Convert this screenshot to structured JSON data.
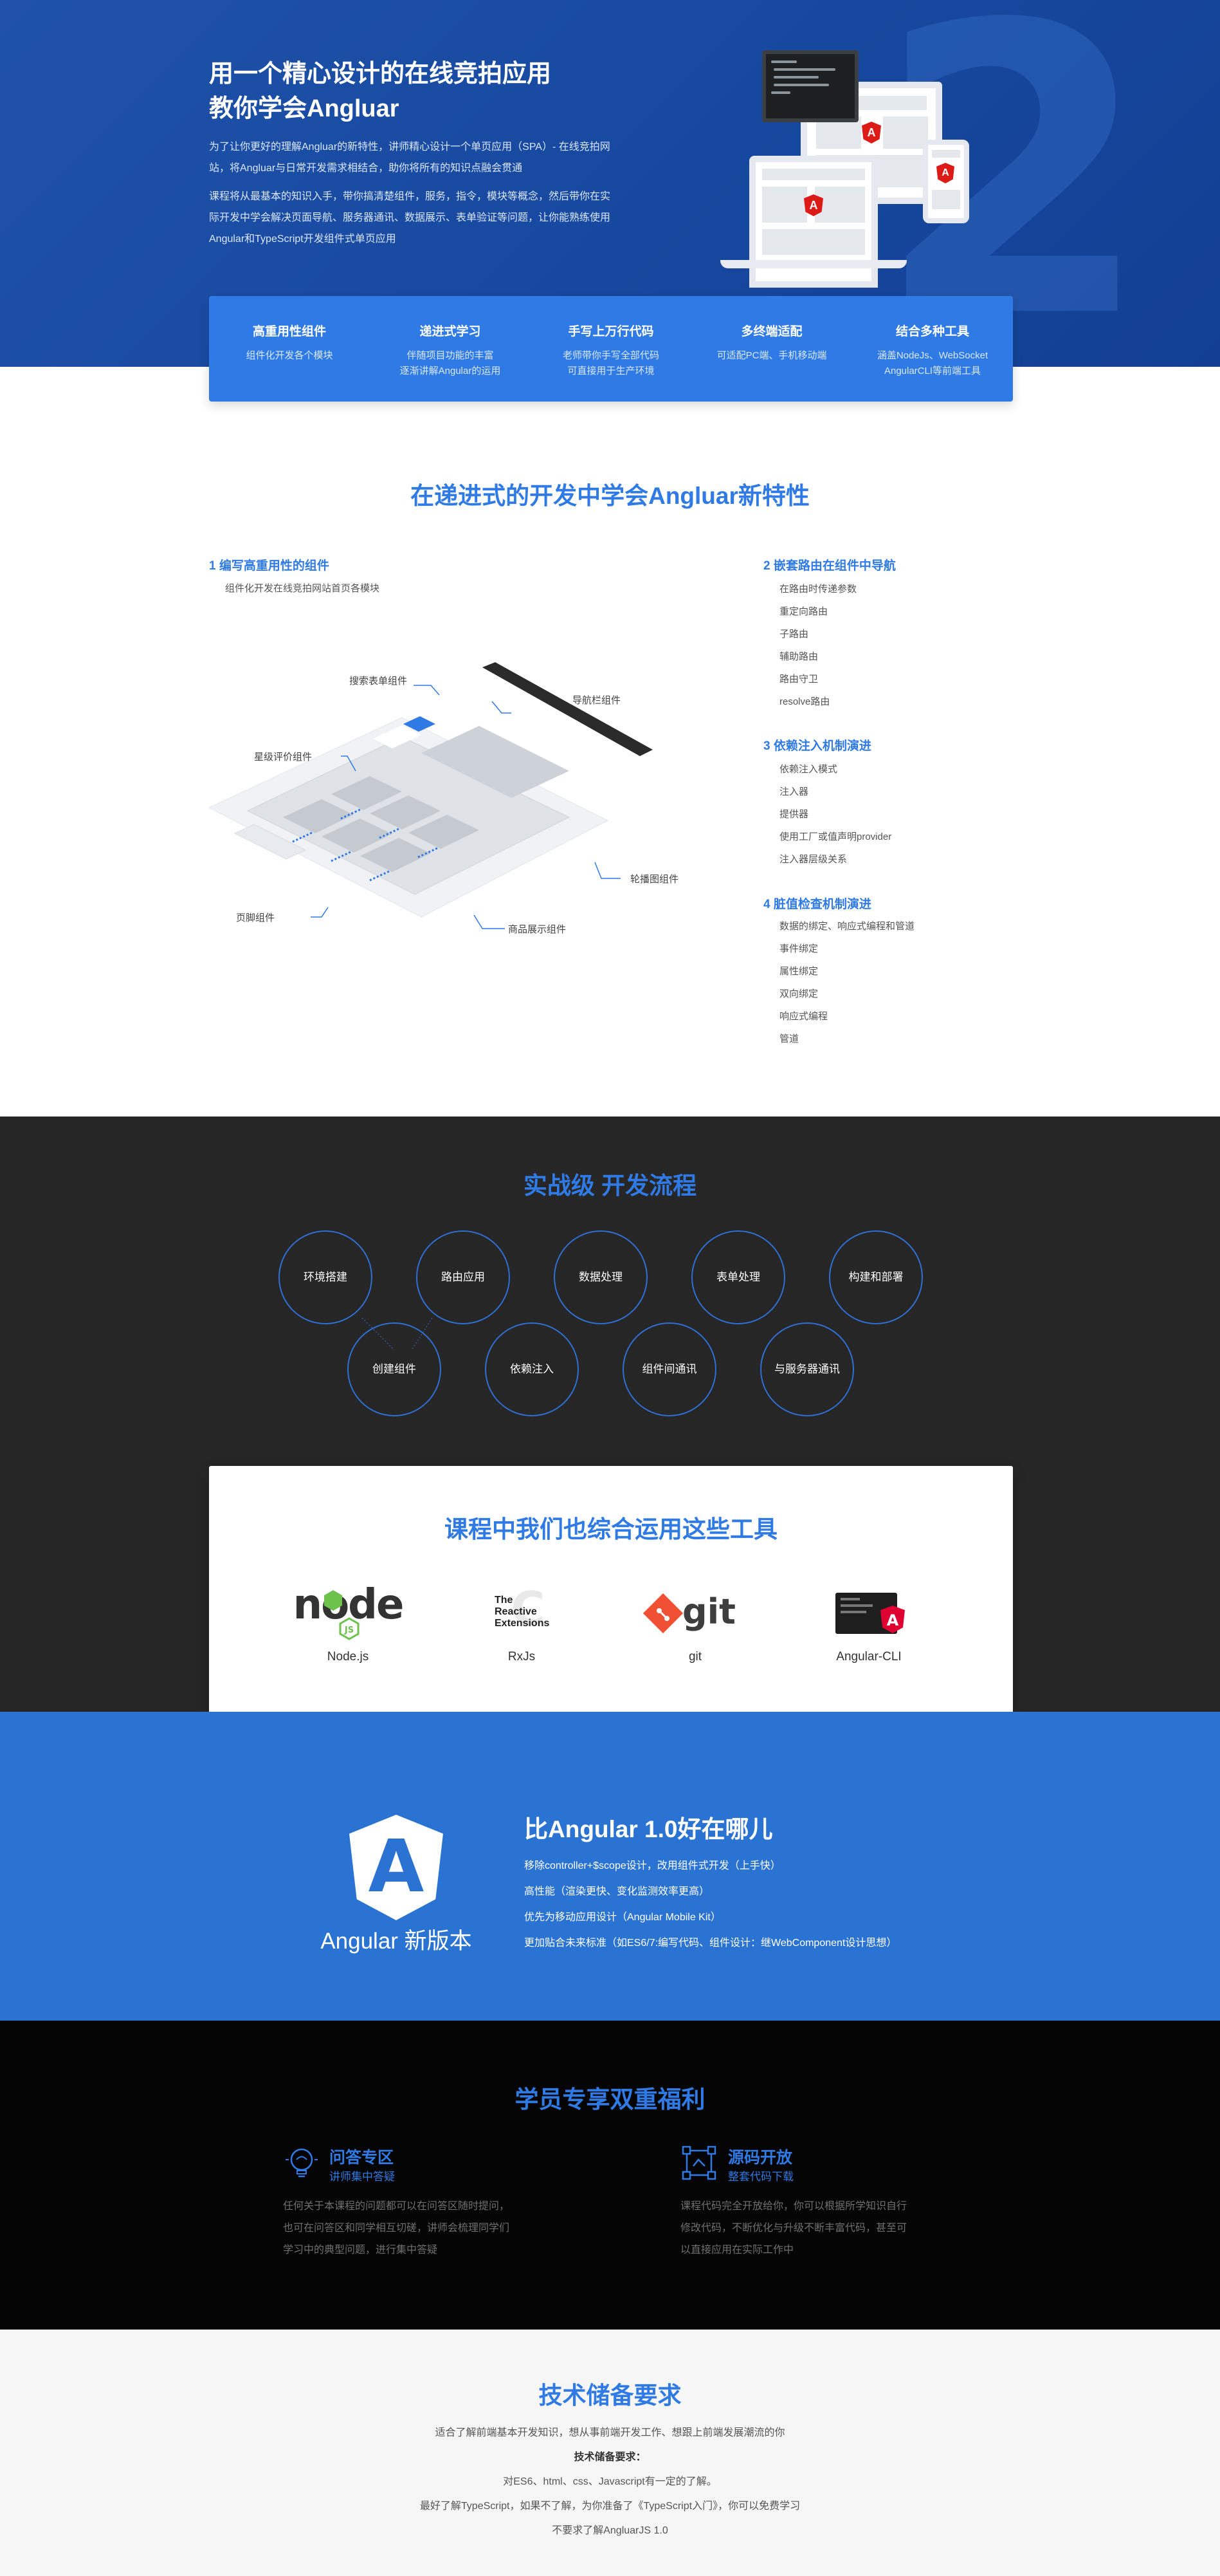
{
  "hero": {
    "title_line1": "用一个精心设计的在线竞拍应用",
    "title_line2": "教你学会Angluar",
    "para1_line1": "为了让你更好的理解Angluar的新特性，讲师精心设计一个单页应用（SPA）- 在线竞拍网",
    "para1_line2": "站，将Angluar与日常开发需求相结合，助你将所有的知识点融会贯通",
    "para2_line1": "课程将从最基本的知识入手，带你搞清楚组件，服务，指令，模块等概念，然后带你在实",
    "para2_line2": "际开发中学会解决页面导航、服务器通讯、数据展示、表单验证等问题，让你能熟练使用",
    "para2_line3": "Angular和TypeScript开发组件式单页应用",
    "bg_number": "2",
    "accent": "#2f7ae5"
  },
  "features": [
    {
      "title": "高重用性组件",
      "line1": "组件化开发各个模块",
      "line2": ""
    },
    {
      "title": "递进式学习",
      "line1": "伴随项目功能的丰富",
      "line2": "逐渐讲解Angular的运用"
    },
    {
      "title": "手写上万行代码",
      "line1": "老师带你手写全部代码",
      "line2": "可直接用于生产环境"
    },
    {
      "title": "多终端适配",
      "line1": "可适配PC端、手机移动端",
      "line2": ""
    },
    {
      "title": "结合多种工具",
      "line1": "涵盖NodeJs、WebSocket",
      "line2": "AngularCLI等前端工具"
    }
  ],
  "newfeatures": {
    "title": "在递进式的开发中学会Angluar新特性",
    "topic1": {
      "title": "1  编写高重用性的组件",
      "sub": "组件化开发在线竞拍网站首页各模块"
    },
    "topic2": {
      "title": "2  嵌套路由在组件中导航",
      "items": [
        "在路由时传递参数",
        "重定向路由",
        "子路由",
        "辅助路由",
        "路由守卫",
        "resolve路由"
      ]
    },
    "topic3": {
      "title": "3  依赖注入机制演进",
      "items": [
        "依赖注入模式",
        "注入器",
        "提供器",
        "使用工厂或值声明provider",
        "注入器层级关系"
      ]
    },
    "topic4": {
      "title": "4  脏值检查机制演进",
      "items": [
        "数据的绑定、响应式编程和管道",
        "事件绑定",
        "属性绑定",
        "双向绑定",
        "响应式编程",
        "管道"
      ]
    },
    "diagram_labels": {
      "search": "搜索表单组件",
      "nav": "导航栏组件",
      "rating": "星级评价组件",
      "carousel": "轮播图组件",
      "footer": "页脚组件",
      "product": "商品展示组件"
    }
  },
  "process": {
    "title": "实战级 开发流程",
    "row1": [
      "环境搭建",
      "路由应用",
      "数据处理",
      "表单处理",
      "构建和部署"
    ],
    "row2": [
      "创建组件",
      "依赖注入",
      "组件间通讯",
      "与服务器通讯"
    ]
  },
  "tools": {
    "title": "课程中我们也综合运用这些工具",
    "items": [
      {
        "name": "Node.js",
        "logo_text": "node",
        "icon": "nodejs-logo"
      },
      {
        "name": "RxJs",
        "logo_text": "The Reactive Extensions",
        "icon": "rxjs-logo"
      },
      {
        "name": "git",
        "logo_text": "git",
        "icon": "git-logo"
      },
      {
        "name": "Angular-CLI",
        "logo_text": "A",
        "icon": "angular-cli-logo"
      }
    ]
  },
  "compare": {
    "logo_letter": "A",
    "caption": "Angular 新版本",
    "title": "比Angular 1.0好在哪儿",
    "items": [
      "移除controller+$scope设计，改用组件式开发（上手快）",
      "高性能（渲染更快、变化监测效率更高）",
      "优先为移动应用设计（Angular Mobile Kit）",
      "更加贴合未来标准（如ES6/7:编写代码、组件设计：继WebComponent设计思想）"
    ]
  },
  "benefits": {
    "title": "学员专享双重福利",
    "left": {
      "title": "问答专区",
      "sub": "讲师集中答疑",
      "line1": "任何关于本课程的问题都可以在问答区随时提问，",
      "line2": "也可在问答区和同学相互切磋，讲师会梳理同学们",
      "line3": "学习中的典型问题，进行集中答疑"
    },
    "right": {
      "title": "源码开放",
      "sub": "整套代码下载",
      "line1": "课程代码完全开放给你，你可以根据所学知识自行",
      "line2": "修改代码，不断优化与升级不断丰富代码，甚至可",
      "line3": "以直接应用在实际工作中"
    }
  },
  "requirements": {
    "title": "技术储备要求",
    "line1": "适合了解前端基本开发知识，想从事前端开发工作、想跟上前端发展潮流的你",
    "line2": "技术储备要求：",
    "line3": "对ES6、html、css、Javascript有一定的了解。",
    "line4": "最好了解TypeScript，如果不了解，为你准备了《TypeScript入门》，你可以免费学习",
    "line5": "不要求了解AngluarJS 1.0"
  }
}
